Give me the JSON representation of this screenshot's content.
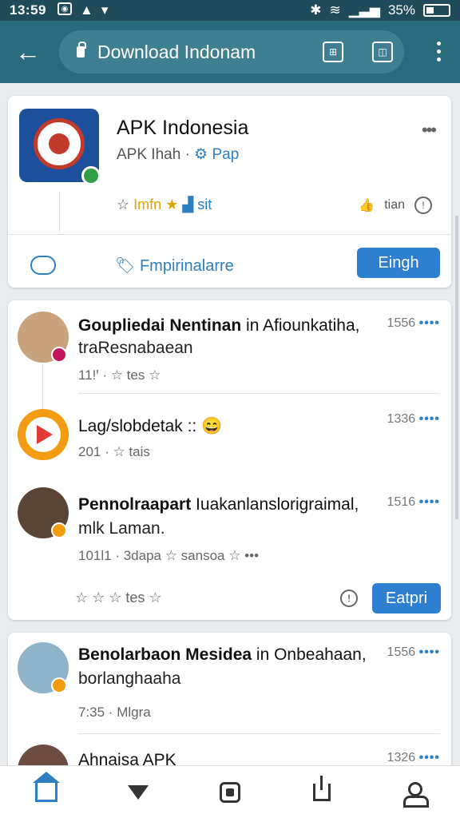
{
  "status_bar": {
    "time": "13:59",
    "battery": "35%",
    "battery_level": 0.35
  },
  "app_bar": {
    "url_text": "Download Indonam"
  },
  "app_card": {
    "title": "APK Indonesia",
    "sub_left": "APK Ihah ·",
    "sub_accent": "Pap",
    "meta_a": "Imfn",
    "meta_b": "sit",
    "like_label": "tian",
    "promo_label": "Fmpirinalarre",
    "action_label": "Eingh"
  },
  "posts": [
    {
      "title_bold": "Goupliedai Nentinan",
      "title_rest": " in Afiounkatiha,",
      "line2": "traResnabaean",
      "meta": "11!ꞌ · ☆ tes ☆",
      "count": "1556"
    },
    {
      "title_bold": "",
      "title_rest": "Lag/slobdetak :: ",
      "line2": "",
      "meta": "201 · ☆ tais",
      "count": "1336"
    },
    {
      "title_bold": "Pennolraapart",
      "title_rest": " Iuakanlanslorigraimal,",
      "line2": "mlk  Laman.",
      "meta": "101l1 · 3dapa ☆ sansoa ☆",
      "count": "1516"
    },
    {
      "title_bold": "Benolarbaon Mesidea",
      "title_rest": " in Onbeahaan,",
      "line2": "borlanghaaha",
      "meta": "7:35 · Mlgra",
      "count": "1556"
    },
    {
      "title_bold": "",
      "title_rest": "Ahnaisa APK",
      "line2": "",
      "meta": "",
      "count": "1326"
    }
  ],
  "post3_footer": {
    "stars": "☆ ☆ ☆ tes ☆",
    "action_label": "Eatpri"
  },
  "colors": {
    "accent": "#2f7fd0",
    "header": "#2a6a7d",
    "statusbar": "#1f4b5a"
  },
  "icons": [
    "back-arrow-icon",
    "lock-icon",
    "bookmark-icon",
    "tab-icon",
    "menu-dots-icon",
    "chat-icon",
    "home-icon",
    "play-icon",
    "record-icon",
    "share-icon",
    "profile-icon"
  ]
}
